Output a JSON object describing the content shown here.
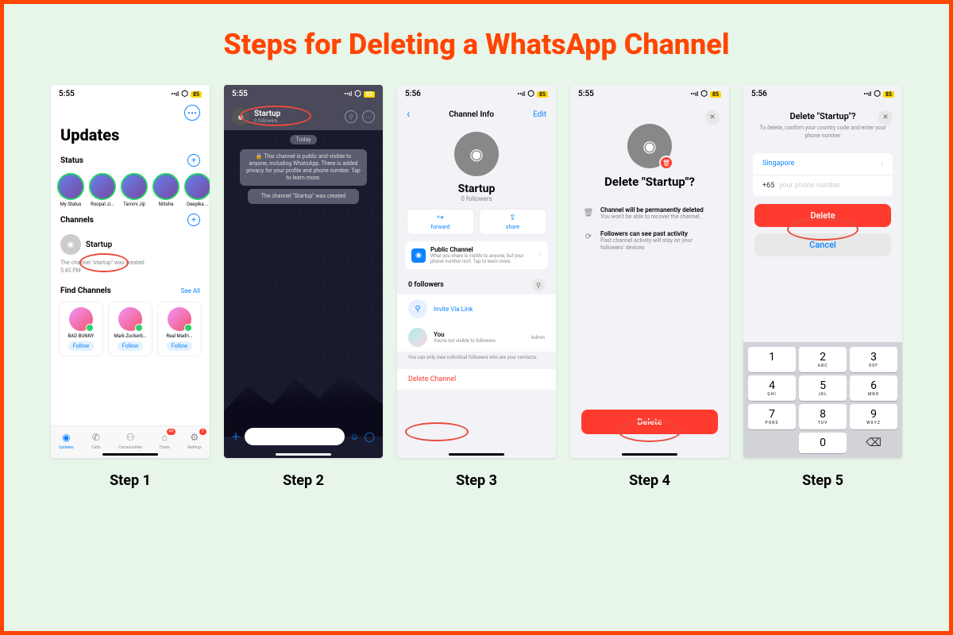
{
  "title": "Steps for Deleting a WhatsApp Channel",
  "steps": {
    "s1": {
      "label": "Step 1",
      "time": "5:55"
    },
    "s2": {
      "label": "Step 2",
      "time": "5:55"
    },
    "s3": {
      "label": "Step 3",
      "time": "5:56"
    },
    "s4": {
      "label": "Step 4",
      "time": "5:55"
    },
    "s5": {
      "label": "Step 5",
      "time": "5:56"
    }
  },
  "step1": {
    "updates": "Updates",
    "status": "Status",
    "status_items": {
      "0": "My Status",
      "1": "Roopal Ji...",
      "2": "Tammi Jiji",
      "3": "Nitisha",
      "4": "Deepika ..."
    },
    "channels": "Channels",
    "channel_name": "Startup",
    "created": "The channel \"startup\" was created",
    "created_time": "5:45 PM",
    "find": "Find Channels",
    "see_all": "See All",
    "find_items": {
      "0": {
        "name": "BAD BUNNY",
        "btn": "Follow"
      },
      "1": {
        "name": "Mark Zuckerb...",
        "btn": "Follow"
      },
      "2": {
        "name": "Real Madri...",
        "btn": "Follow"
      }
    },
    "tabs": {
      "updates": "Updates",
      "calls": "Calls",
      "communities": "Communities",
      "chats": "Chats",
      "settings": "Settings",
      "chats_badge": "49",
      "settings_badge": "1"
    }
  },
  "step2": {
    "channel_name": "Startup",
    "followers": "0 followers",
    "today": "Today",
    "info": "🔒 This channel is public and visible to anyone, including WhatsApp. There is added privacy for your profile and phone number. Tap to learn more.",
    "created": "The channel \"Startup\" was created"
  },
  "step3": {
    "nav_title": "Channel Info",
    "edit": "Edit",
    "name": "Startup",
    "followers": "0 followers",
    "forward": "forward",
    "share": "share",
    "public_title": "Public Channel",
    "public_sub": "What you share is visible to anyone, but your phone number isn't. Tap to learn more.",
    "followers_head": "0 followers",
    "invite": "Invite Via Link",
    "you": "You",
    "you_sub": "You're not visible to followers",
    "admin": "Admin",
    "note": "You can only view individual followers who are your contacts.",
    "delete": "Delete Channel"
  },
  "step4": {
    "title": "Delete \"Startup\"?",
    "info1_title": "Channel will be permanently deleted",
    "info1_sub": "You won't be able to recover the channel.",
    "info2_title": "Followers can see past activity",
    "info2_sub": "Past channel activity will stay on your followers' devices",
    "delete": "Delete"
  },
  "step5": {
    "title": "Delete \"Startup\"?",
    "sub": "To delete, confirm your country code and enter your phone number",
    "country": "Singapore",
    "code": "+65",
    "placeholder": "your phone number",
    "delete": "Delete",
    "cancel": "Cancel",
    "keys": {
      "1": {
        "n": "1",
        "l": ""
      },
      "2": {
        "n": "2",
        "l": "ABC"
      },
      "3": {
        "n": "3",
        "l": "DEF"
      },
      "4": {
        "n": "4",
        "l": "GHI"
      },
      "5": {
        "n": "5",
        "l": "JKL"
      },
      "6": {
        "n": "6",
        "l": "MNO"
      },
      "7": {
        "n": "7",
        "l": "PQRS"
      },
      "8": {
        "n": "8",
        "l": "TUV"
      },
      "9": {
        "n": "9",
        "l": "WXYZ"
      },
      "0": {
        "n": "0",
        "l": ""
      }
    }
  }
}
